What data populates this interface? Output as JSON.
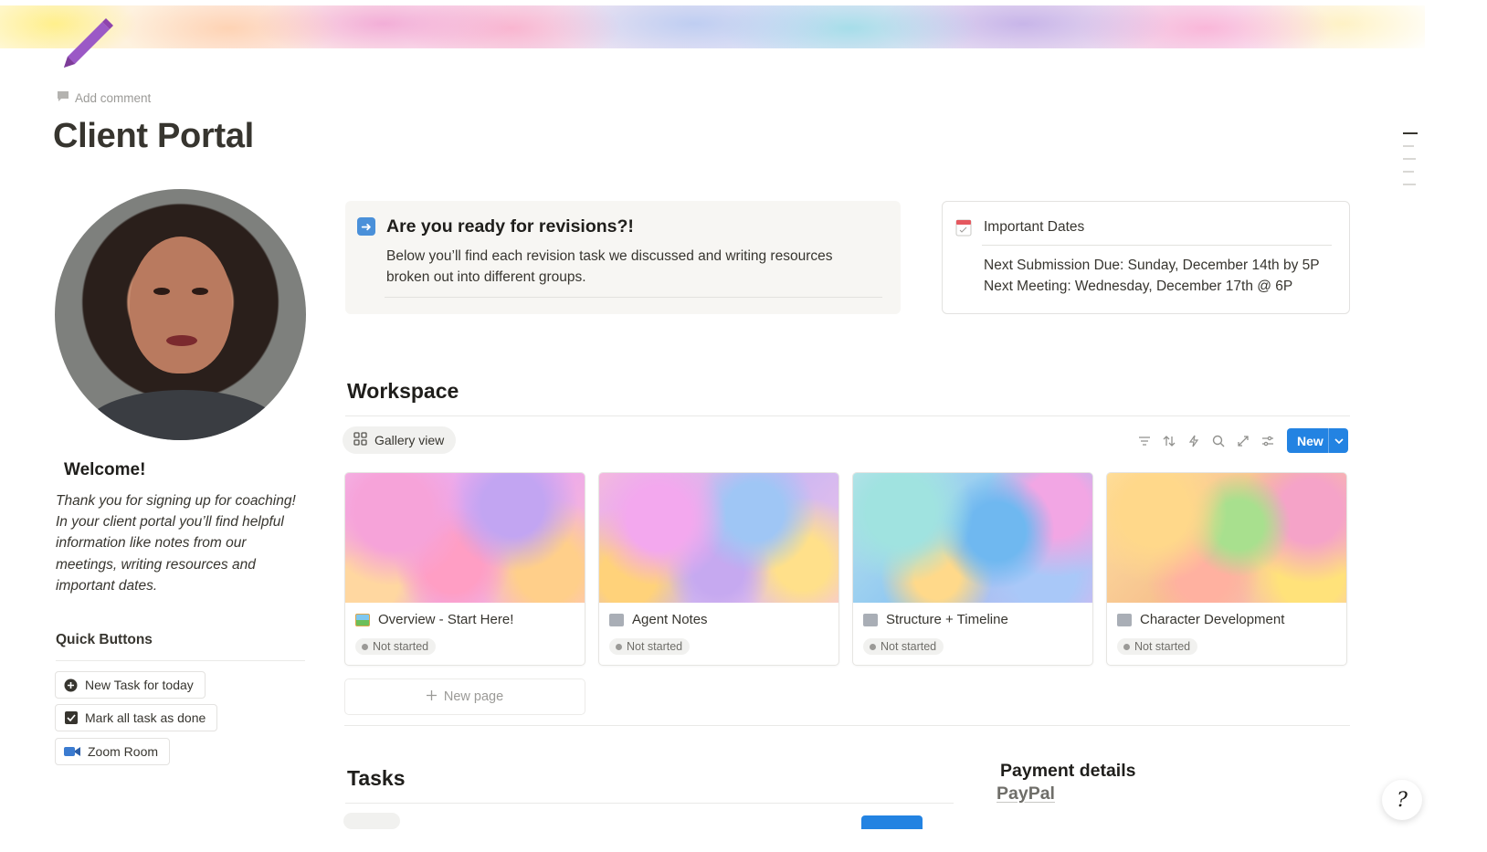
{
  "page": {
    "add_comment": "Add comment",
    "title": "Client Portal",
    "icon": "pencil-icon"
  },
  "sidebar": {
    "welcome_title": "Welcome!",
    "welcome_text": "Thank you for signing up for coaching! In your client portal you’ll find helpful information like notes from our meetings, writing resources and important dates.",
    "quick_buttons_title": "Quick Buttons",
    "quick_buttons": [
      {
        "label": "New Task for today",
        "icon": "plus-circle-icon"
      },
      {
        "label": "Mark all task as done",
        "icon": "checkbox-icon"
      },
      {
        "label": "Zoom Room",
        "icon": "video-camera-icon"
      }
    ]
  },
  "callout": {
    "icon": "arrow-right-icon",
    "title": "Are you ready for revisions?!",
    "body": "Below you’ll find each revision task we discussed and writing resources broken out into different groups."
  },
  "dates": {
    "icon": "calendar-icon",
    "title": "Important Dates",
    "lines": [
      "Next Submission Due: Sunday, December 14th by 5P",
      "Next Meeting: Wednesday, December 17th @ 6P"
    ]
  },
  "workspace": {
    "title": "Workspace",
    "view_label": "Gallery view",
    "tools": [
      "filter-icon",
      "sort-icon",
      "lightning-icon",
      "search-icon",
      "expand-icon",
      "settings-icon"
    ],
    "new_label": "New",
    "cards": [
      {
        "name": "Overview - Start Here!",
        "status": "Not started",
        "icon": "picture-icon"
      },
      {
        "name": "Agent Notes",
        "status": "Not started",
        "icon": "folder-icon"
      },
      {
        "name": "Structure + Timeline",
        "status": "Not started",
        "icon": "folder-icon"
      },
      {
        "name": "Character Development",
        "status": "Not started",
        "icon": "folder-icon"
      }
    ],
    "new_page_label": "New page"
  },
  "tasks": {
    "title": "Tasks"
  },
  "payment": {
    "title": "Payment details",
    "link": "PayPal"
  },
  "colors": {
    "accent": "#2383e2",
    "text": "#37352f",
    "muted": "#9b9a97"
  }
}
